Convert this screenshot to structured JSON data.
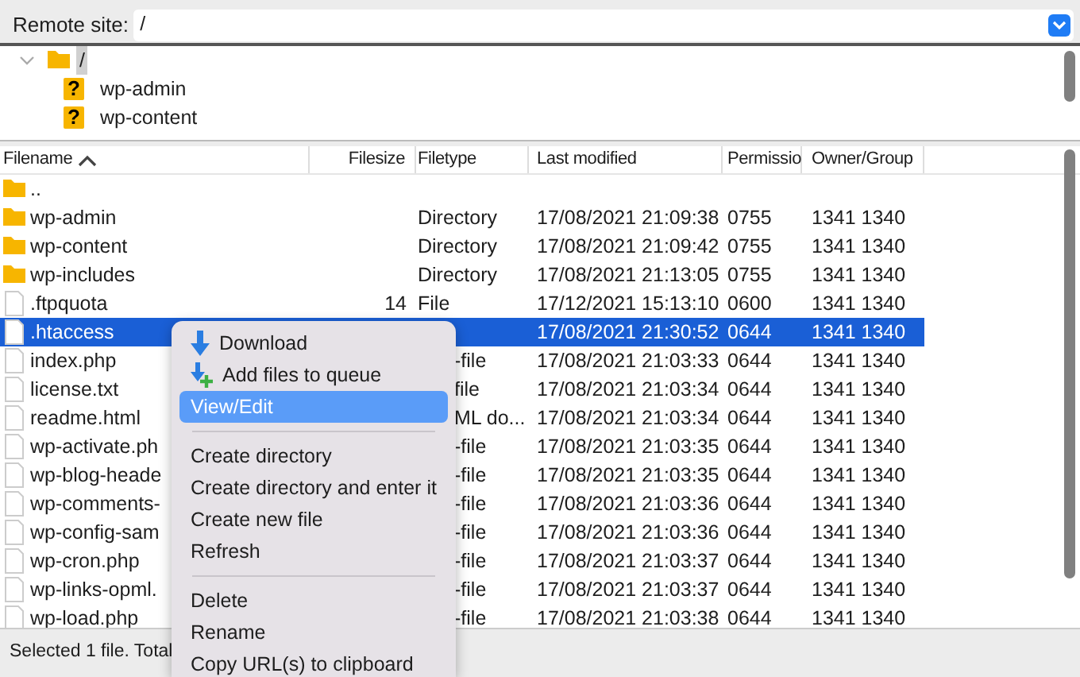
{
  "remote_site": {
    "label": "Remote site:",
    "value": "/"
  },
  "tree": [
    {
      "label": "/",
      "expanded": true,
      "selected": true,
      "kind": "folder",
      "children": [
        {
          "label": "wp-admin",
          "icon": "?"
        },
        {
          "label": "wp-content",
          "icon": "?"
        }
      ]
    }
  ],
  "file_list": {
    "columns": [
      {
        "label": "Filename",
        "sorted": true
      },
      {
        "label": "Filesize"
      },
      {
        "label": "Filetype"
      },
      {
        "label": "Last modified"
      },
      {
        "label": "Permissio"
      },
      {
        "label": "Owner/Group"
      }
    ],
    "rows": [
      {
        "kind": "folder",
        "name": "..",
        "selected": false
      },
      {
        "kind": "folder",
        "name": "wp-admin",
        "filetype": "Directory",
        "modified": "17/08/2021 21:09:38",
        "permissions": "0755",
        "owner": "1341 1340",
        "selected": false
      },
      {
        "kind": "folder",
        "name": "wp-content",
        "filetype": "Directory",
        "modified": "17/08/2021 21:09:42",
        "permissions": "0755",
        "owner": "1341 1340",
        "selected": false
      },
      {
        "kind": "folder",
        "name": "wp-includes",
        "filetype": "Directory",
        "modified": "17/08/2021 21:13:05",
        "permissions": "0755",
        "owner": "1341 1340",
        "selected": false
      },
      {
        "kind": "file",
        "name": ".ftpquota",
        "filesize": "14",
        "filetype": "File",
        "modified": "17/12/2021 15:13:10",
        "permissions": "0600",
        "owner": "1341 1340",
        "selected": false
      },
      {
        "kind": "file",
        "name": ".htaccess",
        "modified": "17/08/2021 21:30:52",
        "permissions": "0644",
        "owner": "1341 1340",
        "selected": true
      },
      {
        "kind": "file",
        "name": "index.php",
        "filetype": "-file",
        "modified": "17/08/2021 21:03:33",
        "permissions": "0644",
        "owner": "1341 1340",
        "selected": false
      },
      {
        "kind": "file",
        "name": "license.txt",
        "filetype": "file",
        "modified": "17/08/2021 21:03:34",
        "permissions": "0644",
        "owner": "1341 1340",
        "selected": false
      },
      {
        "kind": "file",
        "name": "readme.html",
        "filetype": "ML do...",
        "modified": "17/08/2021 21:03:34",
        "permissions": "0644",
        "owner": "1341 1340",
        "selected": false
      },
      {
        "kind": "file",
        "name": "wp-activate.ph",
        "filetype": "-file",
        "modified": "17/08/2021 21:03:35",
        "permissions": "0644",
        "owner": "1341 1340",
        "selected": false
      },
      {
        "kind": "file",
        "name": "wp-blog-heade",
        "filetype": "-file",
        "modified": "17/08/2021 21:03:35",
        "permissions": "0644",
        "owner": "1341 1340",
        "selected": false
      },
      {
        "kind": "file",
        "name": "wp-comments-",
        "filetype": "-file",
        "modified": "17/08/2021 21:03:36",
        "permissions": "0644",
        "owner": "1341 1340",
        "selected": false
      },
      {
        "kind": "file",
        "name": "wp-config-sam",
        "filetype": "-file",
        "modified": "17/08/2021 21:03:36",
        "permissions": "0644",
        "owner": "1341 1340",
        "selected": false
      },
      {
        "kind": "file",
        "name": "wp-cron.php",
        "filetype": "-file",
        "modified": "17/08/2021 21:03:37",
        "permissions": "0644",
        "owner": "1341 1340",
        "selected": false
      },
      {
        "kind": "file",
        "name": "wp-links-opml.",
        "filetype": "-file",
        "modified": "17/08/2021 21:03:37",
        "permissions": "0644",
        "owner": "1341 1340",
        "selected": false
      },
      {
        "kind": "file",
        "name": "wp-load.php",
        "filetype": "-file",
        "modified": "17/08/2021 21:03:38",
        "permissions": "0644",
        "owner": "1341 1340",
        "selected": false
      }
    ]
  },
  "status_bar": "Selected 1 file. Total",
  "context_menu": {
    "items": [
      {
        "kind": "download",
        "label": "Download",
        "selected": false
      },
      {
        "kind": "queue",
        "label": "Add files to queue",
        "selected": false
      },
      {
        "kind": "item",
        "label": "View/Edit",
        "selected": true
      },
      {
        "kind": "separator"
      },
      {
        "kind": "item",
        "label": "Create directory",
        "selected": false
      },
      {
        "kind": "item",
        "label": "Create directory and enter it",
        "selected": false
      },
      {
        "kind": "item",
        "label": "Create new file",
        "selected": false
      },
      {
        "kind": "item",
        "label": "Refresh",
        "selected": false
      },
      {
        "kind": "separator"
      },
      {
        "kind": "item",
        "label": "Delete",
        "selected": false
      },
      {
        "kind": "item",
        "label": "Rename",
        "selected": false
      },
      {
        "kind": "item",
        "label": "Copy URL(s) to clipboard",
        "selected": false
      }
    ]
  }
}
